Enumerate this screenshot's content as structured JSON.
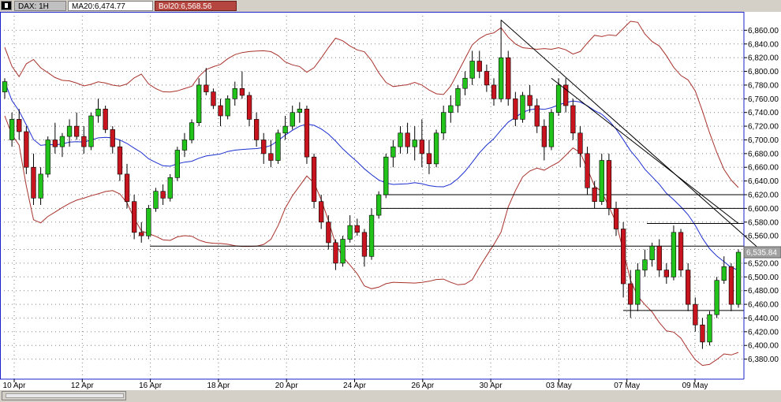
{
  "header": {
    "symbol_label": "DAX: 1H",
    "ma_label": "MA20:6,474.77",
    "bol_label": "Bol20:6,568.56"
  },
  "colors": {
    "up": "#22c41c",
    "down": "#c8141e",
    "ma": "#1c2ed0",
    "bollinger": "#a8322c",
    "trendline": "#000000",
    "price_tag": "#a0a0a0"
  },
  "chart_data": {
    "type": "candlestick",
    "ylim": [
      6360,
      6880
    ],
    "y_ticks": [
      "6,380.00",
      "6,400.00",
      "6,420.00",
      "6,440.00",
      "6,460.00",
      "6,480.00",
      "6,500.00",
      "6,520.00",
      "6,540.00",
      "6,560.00",
      "6,580.00",
      "6,600.00",
      "6,620.00",
      "6,640.00",
      "6,660.00",
      "6,680.00",
      "6,700.00",
      "6,720.00",
      "6,740.00",
      "6,760.00",
      "6,780.00",
      "6,800.00",
      "6,820.00",
      "6,840.00",
      "6,860.00"
    ],
    "x_ticks": [
      "10 Apr",
      "12 Apr",
      "16 Apr",
      "18 Apr",
      "20 Apr",
      "24 Apr",
      "26 Apr",
      "30 Apr",
      "03 May",
      "07 May",
      "09 May"
    ],
    "last_price_label": "6,535.84",
    "horizontal_levels": [
      6620,
      6600,
      6578,
      6545,
      6451
    ],
    "ohlc": [
      [
        6770,
        6790,
        6760,
        6785
      ],
      [
        6700,
        6740,
        6690,
        6730
      ],
      [
        6730,
        6745,
        6700,
        6712
      ],
      [
        6712,
        6720,
        6650,
        6660
      ],
      [
        6660,
        6680,
        6605,
        6615
      ],
      [
        6615,
        6660,
        6605,
        6650
      ],
      [
        6650,
        6705,
        6645,
        6700
      ],
      [
        6700,
        6725,
        6680,
        6690
      ],
      [
        6690,
        6710,
        6675,
        6705
      ],
      [
        6705,
        6730,
        6690,
        6720
      ],
      [
        6720,
        6740,
        6700,
        6705
      ],
      [
        6705,
        6720,
        6680,
        6690
      ],
      [
        6690,
        6740,
        6685,
        6735
      ],
      [
        6735,
        6760,
        6725,
        6745
      ],
      [
        6745,
        6750,
        6710,
        6715
      ],
      [
        6715,
        6720,
        6680,
        6690
      ],
      [
        6690,
        6700,
        6640,
        6650
      ],
      [
        6650,
        6665,
        6600,
        6610
      ],
      [
        6610,
        6620,
        6555,
        6565
      ],
      [
        6565,
        6580,
        6550,
        6560
      ],
      [
        6560,
        6605,
        6555,
        6600
      ],
      [
        6600,
        6630,
        6595,
        6625
      ],
      [
        6625,
        6635,
        6605,
        6615
      ],
      [
        6615,
        6650,
        6610,
        6645
      ],
      [
        6645,
        6690,
        6640,
        6685
      ],
      [
        6685,
        6710,
        6675,
        6700
      ],
      [
        6700,
        6730,
        6695,
        6725
      ],
      [
        6725,
        6790,
        6720,
        6780
      ],
      [
        6780,
        6805,
        6765,
        6770
      ],
      [
        6770,
        6775,
        6745,
        6750
      ],
      [
        6750,
        6760,
        6720,
        6735
      ],
      [
        6735,
        6765,
        6730,
        6760
      ],
      [
        6760,
        6785,
        6750,
        6775
      ],
      [
        6775,
        6800,
        6760,
        6765
      ],
      [
        6765,
        6770,
        6720,
        6730
      ],
      [
        6730,
        6740,
        6690,
        6700
      ],
      [
        6700,
        6710,
        6665,
        6680
      ],
      [
        6680,
        6700,
        6660,
        6670
      ],
      [
        6670,
        6715,
        6665,
        6710
      ],
      [
        6710,
        6735,
        6700,
        6720
      ],
      [
        6720,
        6750,
        6715,
        6740
      ],
      [
        6740,
        6755,
        6725,
        6745
      ],
      [
        6745,
        6750,
        6665,
        6675
      ],
      [
        6675,
        6680,
        6600,
        6610
      ],
      [
        6610,
        6620,
        6570,
        6580
      ],
      [
        6580,
        6590,
        6540,
        6550
      ],
      [
        6550,
        6555,
        6510,
        6520
      ],
      [
        6520,
        6560,
        6515,
        6555
      ],
      [
        6555,
        6590,
        6550,
        6575
      ],
      [
        6575,
        6585,
        6560,
        6565
      ],
      [
        6565,
        6570,
        6515,
        6530
      ],
      [
        6530,
        6600,
        6525,
        6590
      ],
      [
        6590,
        6625,
        6585,
        6620
      ],
      [
        6620,
        6680,
        6615,
        6675
      ],
      [
        6675,
        6700,
        6660,
        6690
      ],
      [
        6690,
        6720,
        6680,
        6710
      ],
      [
        6710,
        6725,
        6680,
        6690
      ],
      [
        6690,
        6720,
        6670,
        6700
      ],
      [
        6700,
        6730,
        6660,
        6680
      ],
      [
        6680,
        6700,
        6650,
        6665
      ],
      [
        6665,
        6715,
        6660,
        6710
      ],
      [
        6710,
        6750,
        6700,
        6740
      ],
      [
        6740,
        6765,
        6725,
        6750
      ],
      [
        6750,
        6780,
        6740,
        6775
      ],
      [
        6775,
        6800,
        6765,
        6790
      ],
      [
        6790,
        6830,
        6780,
        6815
      ],
      [
        6815,
        6830,
        6790,
        6800
      ],
      [
        6800,
        6810,
        6770,
        6780
      ],
      [
        6780,
        6790,
        6750,
        6760
      ],
      [
        6760,
        6875,
        6755,
        6820
      ],
      [
        6820,
        6830,
        6750,
        6760
      ],
      [
        6760,
        6770,
        6720,
        6730
      ],
      [
        6730,
        6770,
        6725,
        6765
      ],
      [
        6765,
        6780,
        6740,
        6750
      ],
      [
        6750,
        6760,
        6710,
        6720
      ],
      [
        6720,
        6730,
        6670,
        6690
      ],
      [
        6690,
        6745,
        6685,
        6740
      ],
      [
        6740,
        6790,
        6735,
        6780
      ],
      [
        6780,
        6790,
        6740,
        6750
      ],
      [
        6750,
        6760,
        6700,
        6710
      ],
      [
        6710,
        6720,
        6660,
        6680
      ],
      [
        6680,
        6690,
        6620,
        6630
      ],
      [
        6630,
        6640,
        6600,
        6610
      ],
      [
        6610,
        6680,
        6605,
        6670
      ],
      [
        6670,
        6680,
        6590,
        6600
      ],
      [
        6600,
        6610,
        6560,
        6570
      ],
      [
        6570,
        6580,
        6470,
        6490
      ],
      [
        6490,
        6510,
        6440,
        6460
      ],
      [
        6460,
        6520,
        6450,
        6510
      ],
      [
        6510,
        6540,
        6500,
        6525
      ],
      [
        6525,
        6550,
        6515,
        6545
      ],
      [
        6545,
        6555,
        6500,
        6510
      ],
      [
        6510,
        6520,
        6490,
        6500
      ],
      [
        6500,
        6575,
        6495,
        6565
      ],
      [
        6565,
        6570,
        6500,
        6510
      ],
      [
        6510,
        6520,
        6450,
        6460
      ],
      [
        6460,
        6470,
        6420,
        6430
      ],
      [
        6430,
        6440,
        6395,
        6405
      ],
      [
        6405,
        6450,
        6400,
        6445
      ],
      [
        6445,
        6500,
        6440,
        6495
      ],
      [
        6495,
        6530,
        6490,
        6515
      ],
      [
        6515,
        6520,
        6450,
        6460
      ],
      [
        6460,
        6540,
        6455,
        6536
      ]
    ]
  }
}
